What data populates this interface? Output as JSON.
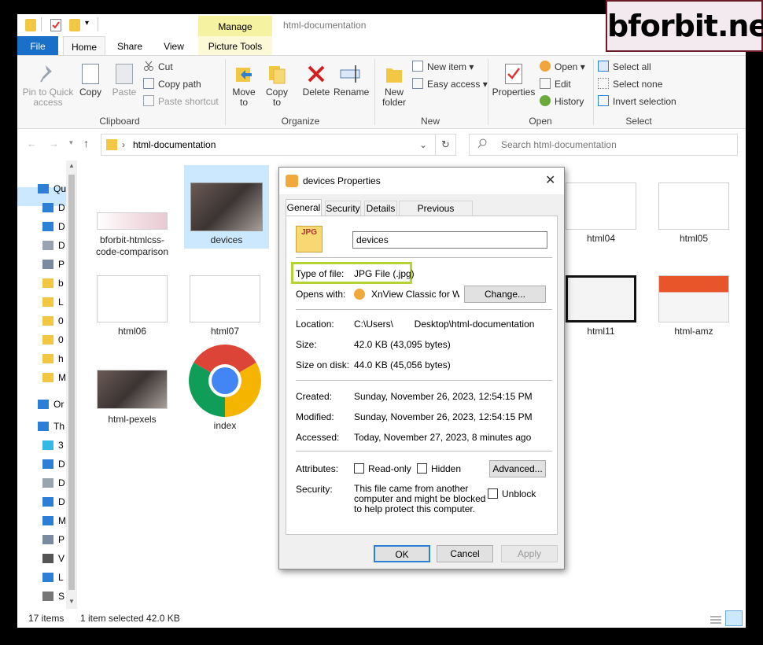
{
  "window": {
    "title": "html-documentation",
    "manage_tab": "Manage",
    "tabs": [
      "File",
      "Home",
      "Share",
      "View",
      "Picture Tools"
    ]
  },
  "ribbon": {
    "clipboard": {
      "label": "Clipboard",
      "pin": "Pin to Quick access",
      "copy": "Copy",
      "paste": "Paste",
      "cut": "Cut",
      "copy_path": "Copy path",
      "paste_shortcut": "Paste shortcut"
    },
    "organize": {
      "label": "Organize",
      "move_to": "Move to",
      "copy_to": "Copy to",
      "delete": "Delete",
      "rename": "Rename"
    },
    "new": {
      "label": "New",
      "new_folder": "New folder",
      "new_item": "New item",
      "easy_access": "Easy access"
    },
    "open": {
      "label": "Open",
      "properties": "Properties",
      "open": "Open",
      "edit": "Edit",
      "history": "History"
    },
    "select": {
      "label": "Select",
      "select_all": "Select all",
      "select_none": "Select none",
      "invert": "Invert selection"
    }
  },
  "address": {
    "path": "html-documentation",
    "search_placeholder": "Search html-documentation"
  },
  "nav_pane": {
    "items": [
      "Qu",
      "D",
      "D",
      "D",
      "P",
      "b",
      "L",
      "0",
      "0",
      "h",
      "M",
      "Or",
      "Th",
      "3",
      "D",
      "D",
      "D",
      "M",
      "P",
      "V",
      "L",
      "S"
    ]
  },
  "files": [
    {
      "name": "bforbit-htmlcss-code-comparison"
    },
    {
      "name": "devices"
    },
    {
      "name": "html04"
    },
    {
      "name": "html05"
    },
    {
      "name": "html06"
    },
    {
      "name": "html07"
    },
    {
      "name": "html11"
    },
    {
      "name": "html-amz"
    },
    {
      "name": "html-pexels"
    },
    {
      "name": "index"
    }
  ],
  "status": {
    "count": "17 items",
    "selection": "1 item selected  42.0 KB"
  },
  "dialog": {
    "title": "devices Properties",
    "tabs": [
      "General",
      "Security",
      "Details",
      "Previous Versions"
    ],
    "icon_text": "JPG",
    "filename": "devices",
    "type_label": "Type of file:",
    "type_value": "JPG File (.jpg)",
    "opens_label": "Opens with:",
    "opens_value": "XnView Classic for Wind",
    "change_btn": "Change...",
    "location_label": "Location:",
    "location_value": "C:\\Users\\        Desktop\\html-documentation",
    "size_label": "Size:",
    "size_value": "42.0 KB (43,095 bytes)",
    "disk_label": "Size on disk:",
    "disk_value": "44.0 KB (45,056 bytes)",
    "created_label": "Created:",
    "created_value": "Sunday, November 26, 2023, 12:54:15 PM",
    "modified_label": "Modified:",
    "modified_value": "Sunday, November 26, 2023, 12:54:15 PM",
    "accessed_label": "Accessed:",
    "accessed_value": "Today, November 27, 2023, 8 minutes ago",
    "attributes_label": "Attributes:",
    "readonly": "Read-only",
    "hidden": "Hidden",
    "advanced_btn": "Advanced...",
    "security_label": "Security:",
    "security_text": "This file came from another computer and might be blocked to help protect this computer.",
    "unblock": "Unblock",
    "ok": "OK",
    "cancel": "Cancel",
    "apply": "Apply"
  },
  "watermark": "bforbit.net",
  "colors": {
    "accent": "#1a6fc9",
    "highlight_box": "#b5d334",
    "manage_tab": "#f5f2a1",
    "badge_border": "#6a1b28"
  }
}
